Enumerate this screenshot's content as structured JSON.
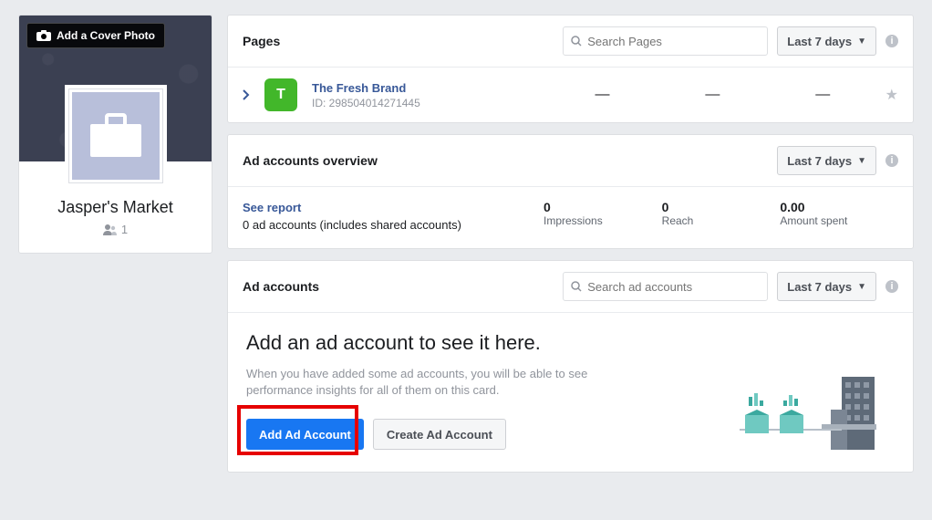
{
  "sidebar": {
    "cover_button": "Add a Cover Photo",
    "profile_name": "Jasper's Market",
    "member_count": "1"
  },
  "pages_card": {
    "title": "Pages",
    "search_placeholder": "Search Pages",
    "range_label": "Last 7 days",
    "row": {
      "badge_letter": "T",
      "name": "The Fresh Brand",
      "id_prefix": "ID: ",
      "id": "298504014271445",
      "m1": "—",
      "m2": "—",
      "m3": "—"
    }
  },
  "overview_card": {
    "title": "Ad accounts overview",
    "range_label": "Last 7 days",
    "see_report": "See report",
    "subtext": "0 ad accounts (includes shared accounts)",
    "stats": [
      {
        "val": "0",
        "lbl": "Impressions"
      },
      {
        "val": "0",
        "lbl": "Reach"
      },
      {
        "val": "0.00",
        "lbl": "Amount spent"
      }
    ]
  },
  "accounts_card": {
    "title": "Ad accounts",
    "search_placeholder": "Search ad accounts",
    "range_label": "Last 7 days",
    "empty_title": "Add an ad account to see it here.",
    "empty_desc": "When you have added some ad accounts, you will be able to see performance insights for all of them on this card.",
    "add_btn": "Add Ad Account",
    "create_btn": "Create Ad Account"
  }
}
